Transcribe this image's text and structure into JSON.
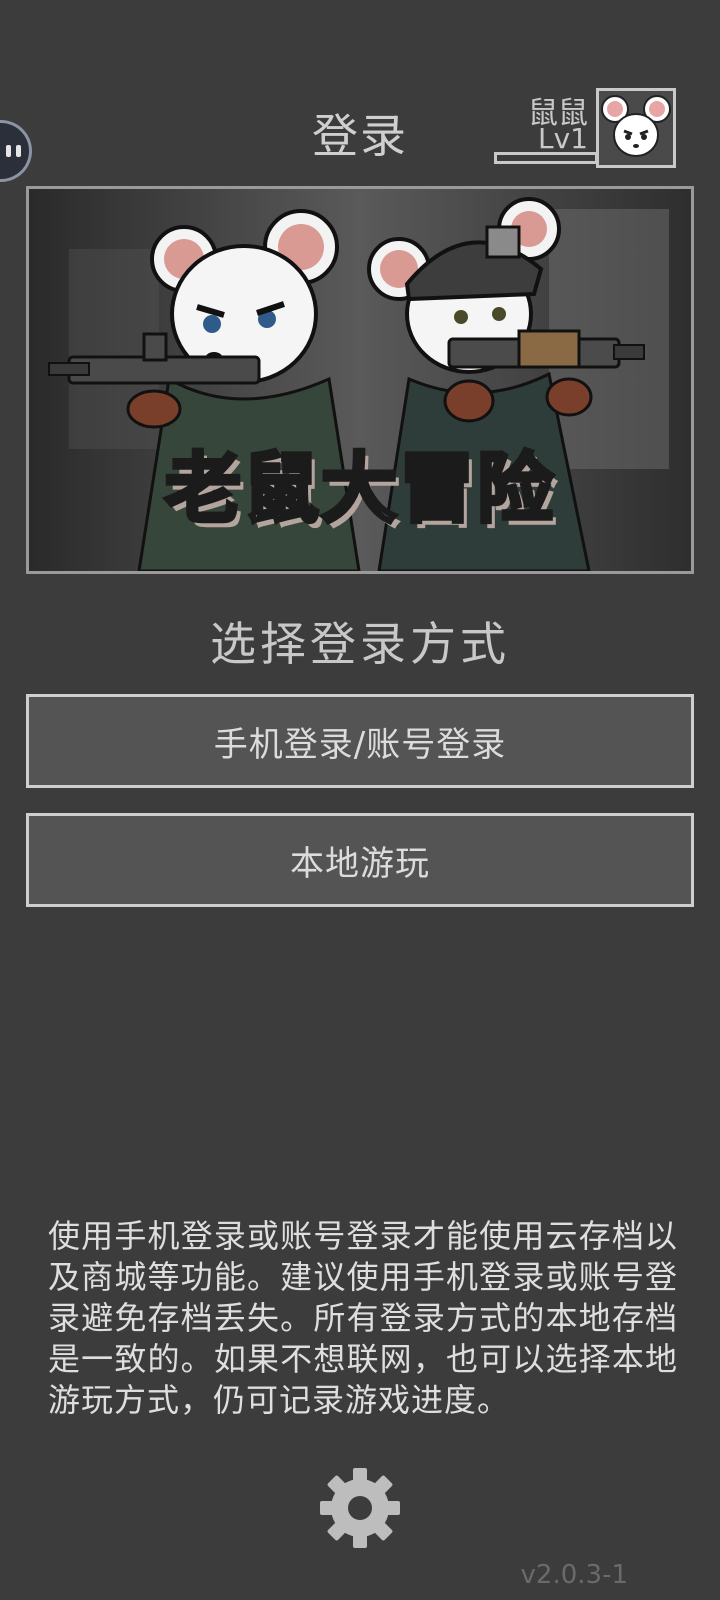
{
  "header": {
    "title": "登录"
  },
  "profile": {
    "name": "鼠鼠",
    "level": "Lv1"
  },
  "banner": {
    "game_title": "老鼠大冒险"
  },
  "login": {
    "subtitle": "选择登录方式",
    "phone_account_label": "手机登录/账号登录",
    "local_play_label": "本地游玩"
  },
  "notice": {
    "text": "使用手机登录或账号登录才能使用云存档以及商城等功能。建议使用手机登录或账号登录避免存档丢失。所有登录方式的本地存档是一致的。如果不想联网，也可以选择本地游玩方式，仍可记录游戏进度。"
  },
  "footer": {
    "version": "v2.0.3-1"
  },
  "icons": {
    "settings": "gear-icon",
    "floating": "floating-menu-icon"
  },
  "colors": {
    "background": "#3c3c3c",
    "button_fill": "#545454",
    "button_border": "#cfcfcf",
    "text": "#d6d6d6"
  }
}
